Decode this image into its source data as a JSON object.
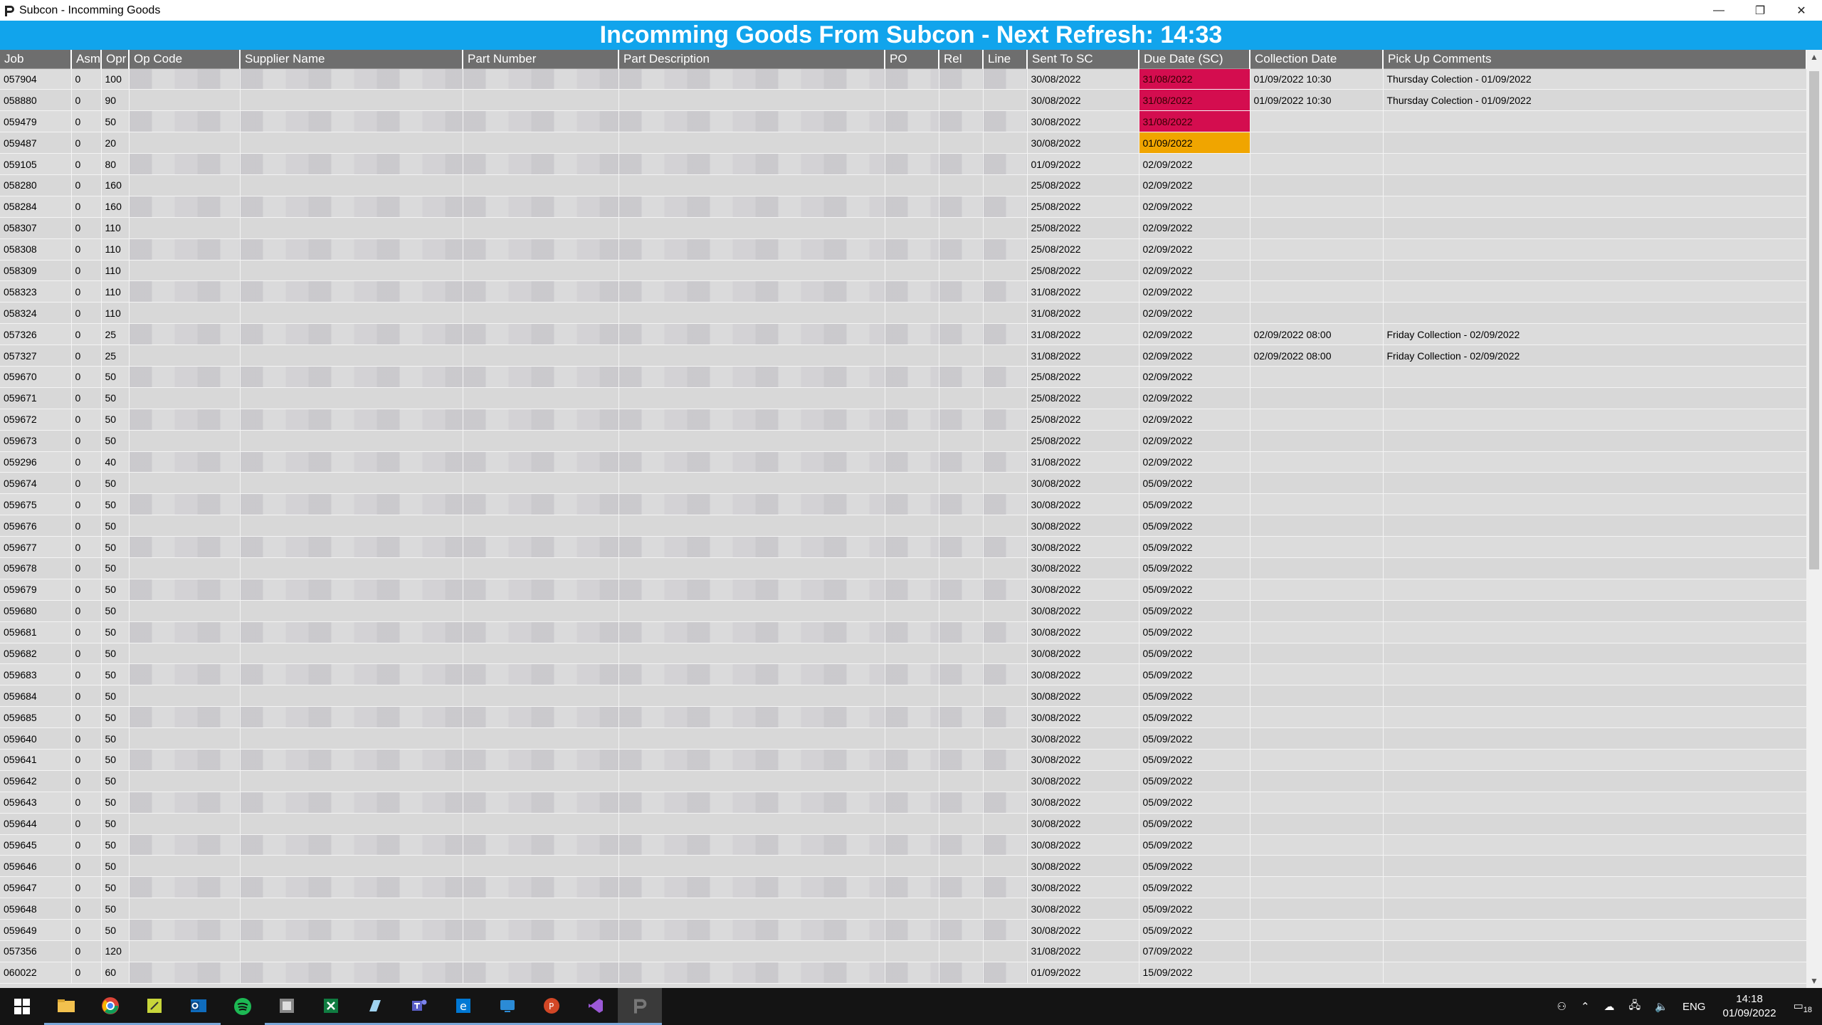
{
  "window": {
    "title": "Subcon - Incomming Goods",
    "minimize": "—",
    "restore": "❐",
    "close": "✕"
  },
  "banner": {
    "title": "Incomming Goods From Subcon - Next Refresh: 14:33"
  },
  "columns": [
    "Job",
    "Asm",
    "Opr",
    "Op Code",
    "Supplier Name",
    "Part Number",
    "Part Description",
    "PO",
    "Rel",
    "Line",
    "Sent To SC",
    "Due Date (SC)",
    "Collection Date",
    "Pick Up Comments"
  ],
  "rows": [
    {
      "job": "057904",
      "asm": "0",
      "opr": "100",
      "sent": "30/08/2022",
      "due": "31/08/2022",
      "status": "bad",
      "coll": "01/09/2022 10:30",
      "comment": "Thursday Colection - 01/09/2022"
    },
    {
      "job": "058880",
      "asm": "0",
      "opr": "90",
      "sent": "30/08/2022",
      "due": "31/08/2022",
      "status": "bad",
      "coll": "01/09/2022 10:30",
      "comment": "Thursday Colection - 01/09/2022"
    },
    {
      "job": "059479",
      "asm": "0",
      "opr": "50",
      "sent": "30/08/2022",
      "due": "31/08/2022",
      "status": "bad",
      "coll": "",
      "comment": ""
    },
    {
      "job": "059487",
      "asm": "0",
      "opr": "20",
      "sent": "30/08/2022",
      "due": "01/09/2022",
      "status": "warn",
      "coll": "",
      "comment": ""
    },
    {
      "job": "059105",
      "asm": "0",
      "opr": "80",
      "sent": "01/09/2022",
      "due": "02/09/2022",
      "status": "",
      "coll": "",
      "comment": ""
    },
    {
      "job": "058280",
      "asm": "0",
      "opr": "160",
      "sent": "25/08/2022",
      "due": "02/09/2022",
      "status": "",
      "coll": "",
      "comment": ""
    },
    {
      "job": "058284",
      "asm": "0",
      "opr": "160",
      "sent": "25/08/2022",
      "due": "02/09/2022",
      "status": "",
      "coll": "",
      "comment": ""
    },
    {
      "job": "058307",
      "asm": "0",
      "opr": "110",
      "sent": "25/08/2022",
      "due": "02/09/2022",
      "status": "",
      "coll": "",
      "comment": ""
    },
    {
      "job": "058308",
      "asm": "0",
      "opr": "110",
      "sent": "25/08/2022",
      "due": "02/09/2022",
      "status": "",
      "coll": "",
      "comment": ""
    },
    {
      "job": "058309",
      "asm": "0",
      "opr": "110",
      "sent": "25/08/2022",
      "due": "02/09/2022",
      "status": "",
      "coll": "",
      "comment": ""
    },
    {
      "job": "058323",
      "asm": "0",
      "opr": "110",
      "sent": "31/08/2022",
      "due": "02/09/2022",
      "status": "",
      "coll": "",
      "comment": ""
    },
    {
      "job": "058324",
      "asm": "0",
      "opr": "110",
      "sent": "31/08/2022",
      "due": "02/09/2022",
      "status": "",
      "coll": "",
      "comment": ""
    },
    {
      "job": "057326",
      "asm": "0",
      "opr": "25",
      "sent": "31/08/2022",
      "due": "02/09/2022",
      "status": "",
      "coll": "02/09/2022 08:00",
      "comment": "Friday Collection - 02/09/2022"
    },
    {
      "job": "057327",
      "asm": "0",
      "opr": "25",
      "sent": "31/08/2022",
      "due": "02/09/2022",
      "status": "",
      "coll": "02/09/2022 08:00",
      "comment": "Friday Collection - 02/09/2022"
    },
    {
      "job": "059670",
      "asm": "0",
      "opr": "50",
      "sent": "25/08/2022",
      "due": "02/09/2022",
      "status": "",
      "coll": "",
      "comment": ""
    },
    {
      "job": "059671",
      "asm": "0",
      "opr": "50",
      "sent": "25/08/2022",
      "due": "02/09/2022",
      "status": "",
      "coll": "",
      "comment": ""
    },
    {
      "job": "059672",
      "asm": "0",
      "opr": "50",
      "sent": "25/08/2022",
      "due": "02/09/2022",
      "status": "",
      "coll": "",
      "comment": ""
    },
    {
      "job": "059673",
      "asm": "0",
      "opr": "50",
      "sent": "25/08/2022",
      "due": "02/09/2022",
      "status": "",
      "coll": "",
      "comment": ""
    },
    {
      "job": "059296",
      "asm": "0",
      "opr": "40",
      "sent": "31/08/2022",
      "due": "02/09/2022",
      "status": "",
      "coll": "",
      "comment": ""
    },
    {
      "job": "059674",
      "asm": "0",
      "opr": "50",
      "sent": "30/08/2022",
      "due": "05/09/2022",
      "status": "",
      "coll": "",
      "comment": ""
    },
    {
      "job": "059675",
      "asm": "0",
      "opr": "50",
      "sent": "30/08/2022",
      "due": "05/09/2022",
      "status": "",
      "coll": "",
      "comment": ""
    },
    {
      "job": "059676",
      "asm": "0",
      "opr": "50",
      "sent": "30/08/2022",
      "due": "05/09/2022",
      "status": "",
      "coll": "",
      "comment": ""
    },
    {
      "job": "059677",
      "asm": "0",
      "opr": "50",
      "sent": "30/08/2022",
      "due": "05/09/2022",
      "status": "",
      "coll": "",
      "comment": ""
    },
    {
      "job": "059678",
      "asm": "0",
      "opr": "50",
      "sent": "30/08/2022",
      "due": "05/09/2022",
      "status": "",
      "coll": "",
      "comment": ""
    },
    {
      "job": "059679",
      "asm": "0",
      "opr": "50",
      "sent": "30/08/2022",
      "due": "05/09/2022",
      "status": "",
      "coll": "",
      "comment": ""
    },
    {
      "job": "059680",
      "asm": "0",
      "opr": "50",
      "sent": "30/08/2022",
      "due": "05/09/2022",
      "status": "",
      "coll": "",
      "comment": ""
    },
    {
      "job": "059681",
      "asm": "0",
      "opr": "50",
      "sent": "30/08/2022",
      "due": "05/09/2022",
      "status": "",
      "coll": "",
      "comment": ""
    },
    {
      "job": "059682",
      "asm": "0",
      "opr": "50",
      "sent": "30/08/2022",
      "due": "05/09/2022",
      "status": "",
      "coll": "",
      "comment": ""
    },
    {
      "job": "059683",
      "asm": "0",
      "opr": "50",
      "sent": "30/08/2022",
      "due": "05/09/2022",
      "status": "",
      "coll": "",
      "comment": ""
    },
    {
      "job": "059684",
      "asm": "0",
      "opr": "50",
      "sent": "30/08/2022",
      "due": "05/09/2022",
      "status": "",
      "coll": "",
      "comment": ""
    },
    {
      "job": "059685",
      "asm": "0",
      "opr": "50",
      "sent": "30/08/2022",
      "due": "05/09/2022",
      "status": "",
      "coll": "",
      "comment": ""
    },
    {
      "job": "059640",
      "asm": "0",
      "opr": "50",
      "sent": "30/08/2022",
      "due": "05/09/2022",
      "status": "",
      "coll": "",
      "comment": ""
    },
    {
      "job": "059641",
      "asm": "0",
      "opr": "50",
      "sent": "30/08/2022",
      "due": "05/09/2022",
      "status": "",
      "coll": "",
      "comment": ""
    },
    {
      "job": "059642",
      "asm": "0",
      "opr": "50",
      "sent": "30/08/2022",
      "due": "05/09/2022",
      "status": "",
      "coll": "",
      "comment": ""
    },
    {
      "job": "059643",
      "asm": "0",
      "opr": "50",
      "sent": "30/08/2022",
      "due": "05/09/2022",
      "status": "",
      "coll": "",
      "comment": ""
    },
    {
      "job": "059644",
      "asm": "0",
      "opr": "50",
      "sent": "30/08/2022",
      "due": "05/09/2022",
      "status": "",
      "coll": "",
      "comment": ""
    },
    {
      "job": "059645",
      "asm": "0",
      "opr": "50",
      "sent": "30/08/2022",
      "due": "05/09/2022",
      "status": "",
      "coll": "",
      "comment": ""
    },
    {
      "job": "059646",
      "asm": "0",
      "opr": "50",
      "sent": "30/08/2022",
      "due": "05/09/2022",
      "status": "",
      "coll": "",
      "comment": ""
    },
    {
      "job": "059647",
      "asm": "0",
      "opr": "50",
      "sent": "30/08/2022",
      "due": "05/09/2022",
      "status": "",
      "coll": "",
      "comment": ""
    },
    {
      "job": "059648",
      "asm": "0",
      "opr": "50",
      "sent": "30/08/2022",
      "due": "05/09/2022",
      "status": "",
      "coll": "",
      "comment": ""
    },
    {
      "job": "059649",
      "asm": "0",
      "opr": "50",
      "sent": "30/08/2022",
      "due": "05/09/2022",
      "status": "",
      "coll": "",
      "comment": ""
    },
    {
      "job": "057356",
      "asm": "0",
      "opr": "120",
      "sent": "31/08/2022",
      "due": "07/09/2022",
      "status": "",
      "coll": "",
      "comment": ""
    },
    {
      "job": "060022",
      "asm": "0",
      "opr": "60",
      "sent": "01/09/2022",
      "due": "15/09/2022",
      "status": "",
      "coll": "",
      "comment": ""
    }
  ],
  "colors": {
    "banner": "#11a4ec",
    "overdue": "#d40d4f",
    "due_today": "#f0a500",
    "header": "#6e6e6e"
  },
  "taskbar": {
    "icons": [
      "windows-start-icon",
      "file-explorer-icon",
      "chrome-icon",
      "sticky-notes-icon",
      "outlook-icon",
      "spotify-icon",
      "app-icon",
      "excel-icon",
      "notepad-icon",
      "teams-icon",
      "edge-icon",
      "remote-desktop-icon",
      "powerpoint-icon",
      "visual-studio-icon",
      "subcon-app-icon"
    ],
    "lang": "ENG",
    "time": "14:18",
    "date": "01/09/2022",
    "notifications": "18"
  }
}
